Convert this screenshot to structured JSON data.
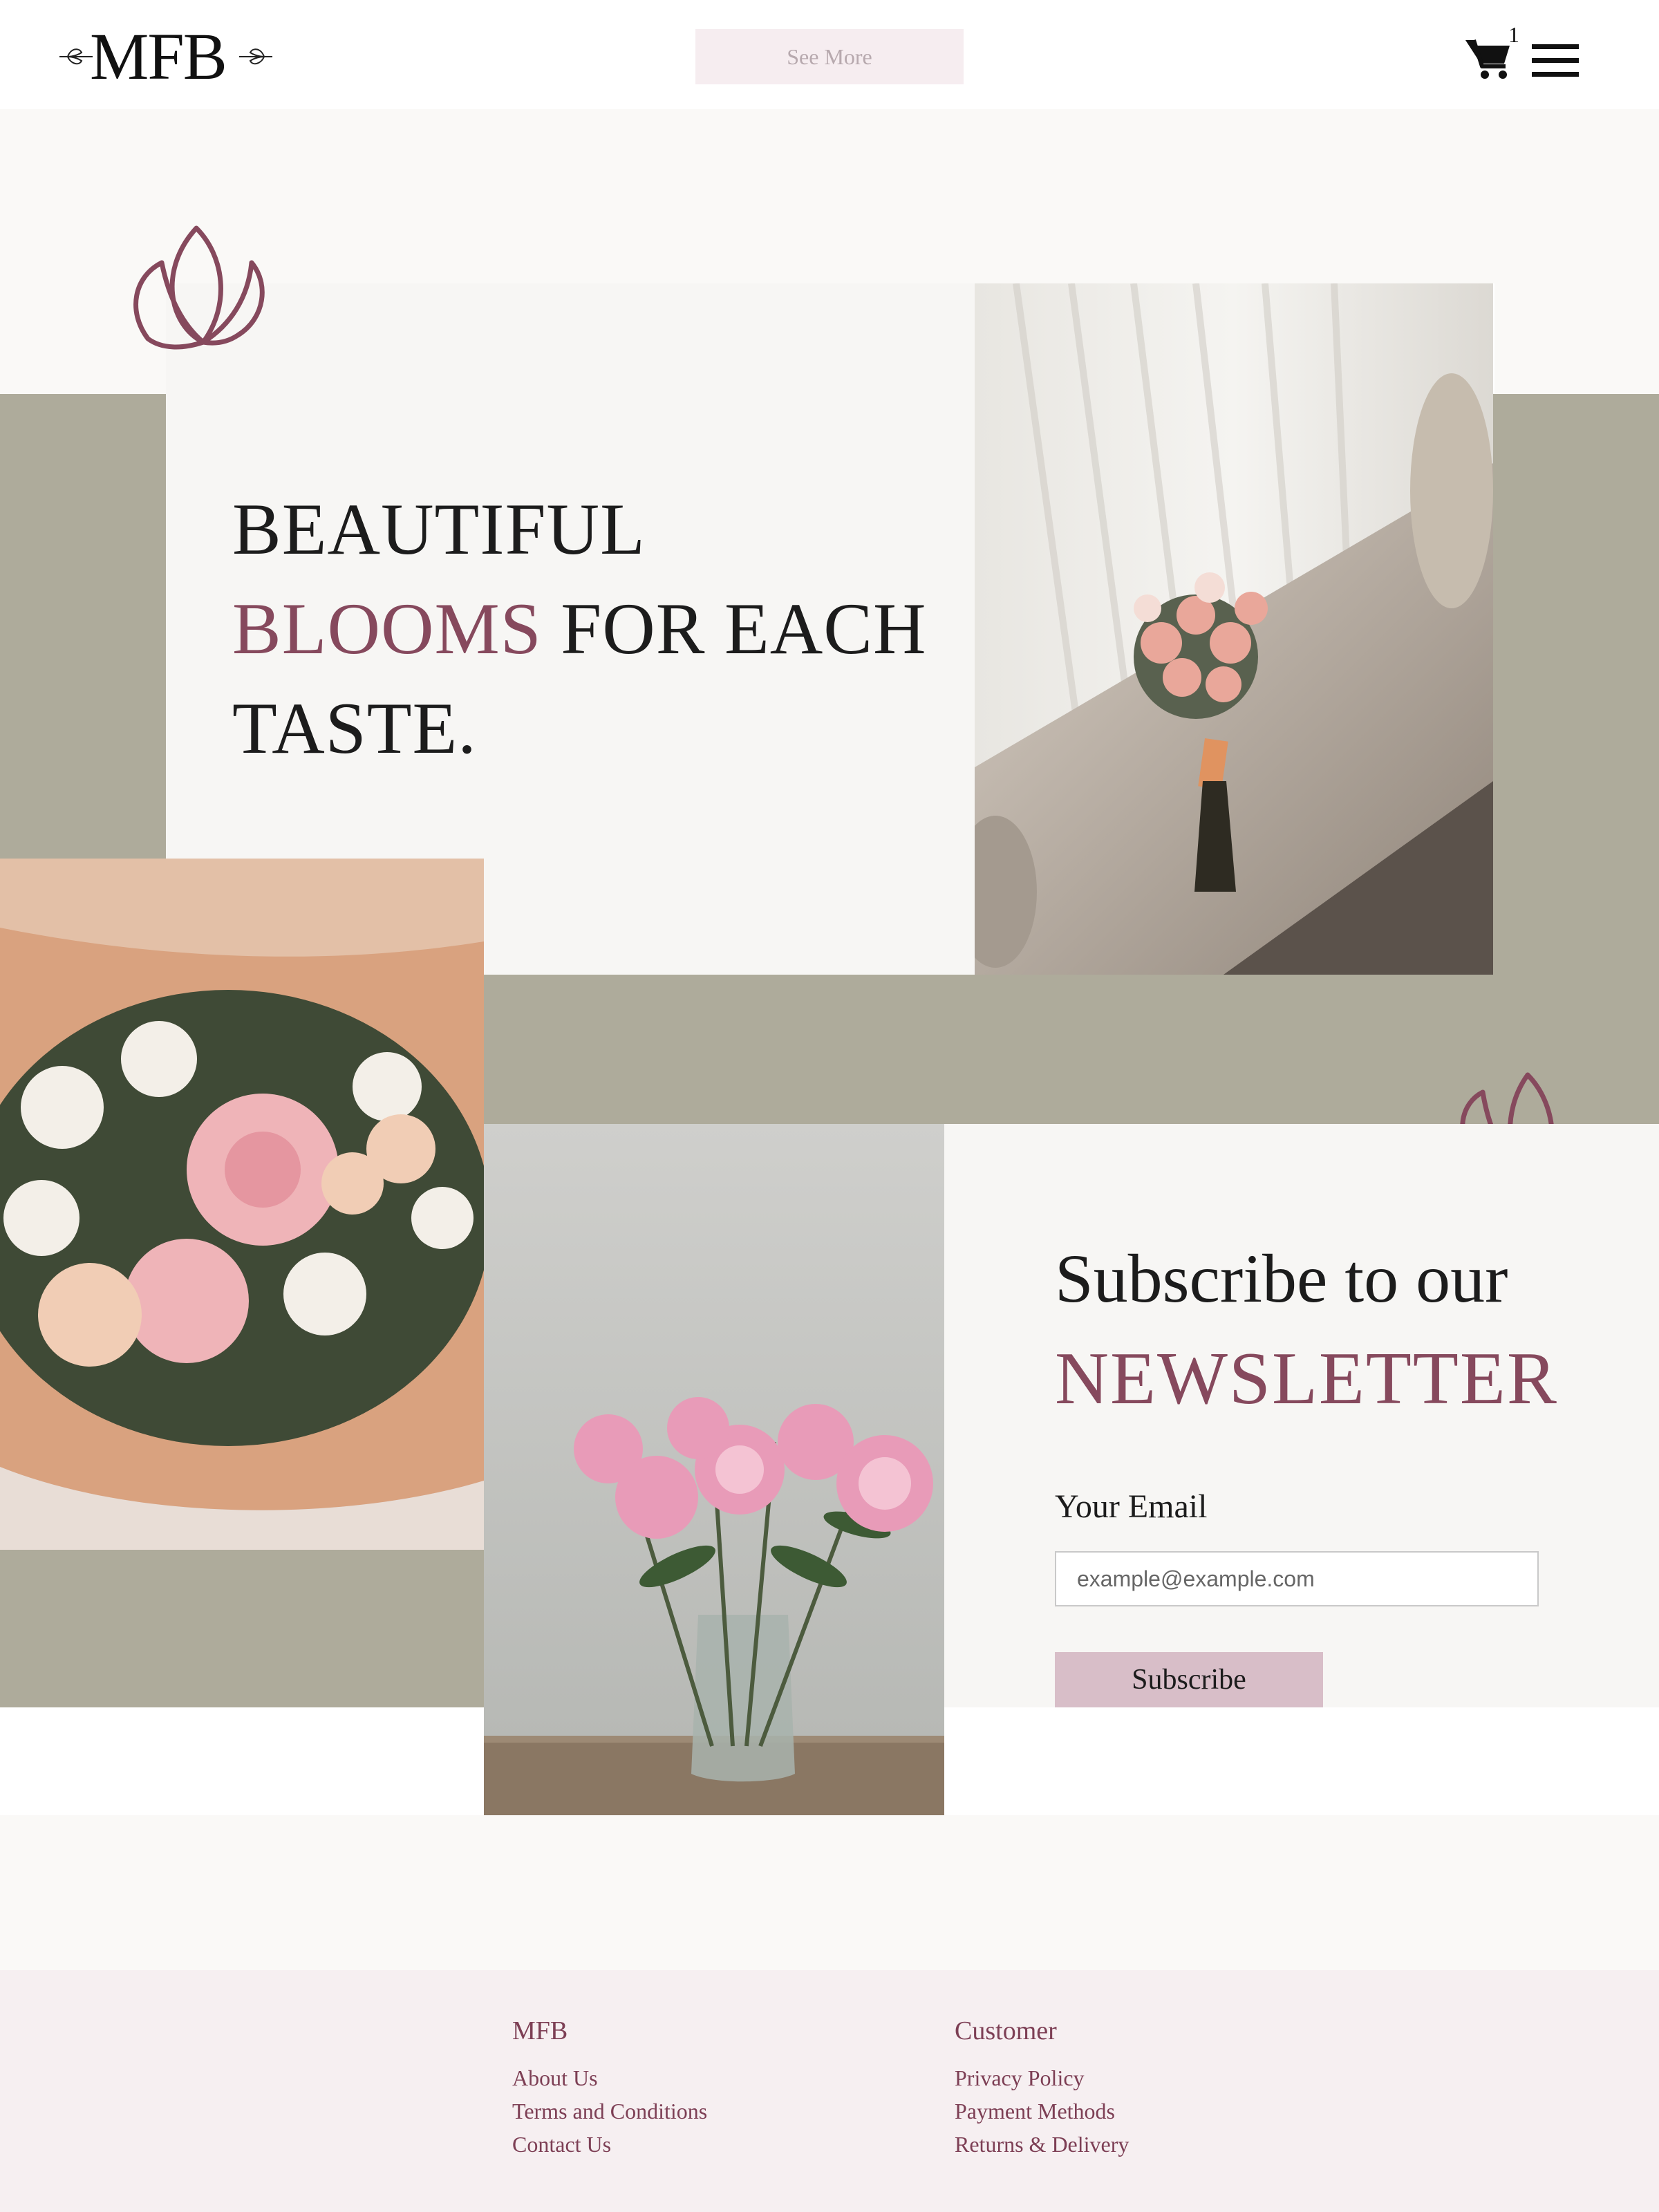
{
  "header": {
    "logo_text": "MFB",
    "see_more_label": "See More",
    "cart_count": "1"
  },
  "hero": {
    "line1": "BEAUTIFUL",
    "line2_accent": "BLOOMS",
    "line2_rest": " FOR EACH",
    "line3": "TASTE."
  },
  "newsletter": {
    "line1": "Subscribe to our",
    "line2": "NEWSLETTER",
    "email_label": "Your Email",
    "email_placeholder": "example@example.com",
    "email_value": "",
    "subscribe_label": "Subscribe"
  },
  "footer": {
    "col1": {
      "heading": "MFB",
      "links": [
        "About Us",
        "Terms and Conditions",
        "Contact Us"
      ]
    },
    "col2": {
      "heading": "Customer",
      "links": [
        "Privacy Policy",
        "Payment Methods",
        "Returns & Delivery"
      ]
    }
  },
  "icons": {
    "cart": "shopping-cart-icon",
    "menu": "hamburger-menu-icon",
    "lotus": "lotus-icon"
  },
  "colors": {
    "accent": "#86495d",
    "sage": "#aeab9b",
    "button_pink": "#d8bec8",
    "see_more_bg": "#f6edf0",
    "footer_bg": "#f6eff1"
  }
}
